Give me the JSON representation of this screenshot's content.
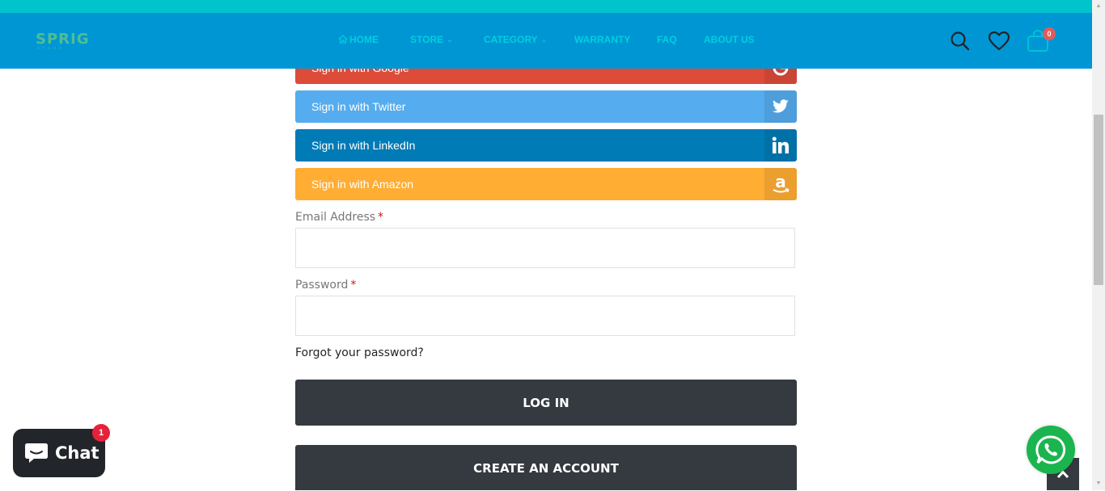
{
  "brand": {
    "logo_text": "SPRIG",
    "logo_tagline": "STORE"
  },
  "nav": {
    "items": [
      {
        "label": "HOME",
        "icon": "home-icon",
        "has_dropdown": false
      },
      {
        "label": "STORE",
        "has_dropdown": true
      },
      {
        "label": "CATEGORY",
        "has_dropdown": true
      },
      {
        "label": "WARRANTY",
        "has_dropdown": false
      },
      {
        "label": "FAQ",
        "has_dropdown": false
      },
      {
        "label": "ABOUT US",
        "has_dropdown": false
      }
    ]
  },
  "header_icons": {
    "search": "search-icon",
    "wishlist": "heart-icon",
    "cart": "cart-icon",
    "cart_count": "0"
  },
  "social_login": [
    {
      "label": "Sign in with Google",
      "icon": "google-icon",
      "color": "#dd4b39"
    },
    {
      "label": "Sign in with Twitter",
      "icon": "twitter-icon",
      "color": "#55acee"
    },
    {
      "label": "Sign in with LinkedIn",
      "icon": "linkedin-icon",
      "color": "#007bb6"
    },
    {
      "label": "Sign in with Amazon",
      "icon": "amazon-icon",
      "color": "#ffad33"
    }
  ],
  "form": {
    "email_label": "Email Address",
    "password_label": "Password",
    "required_mark": "*",
    "email_value": "",
    "password_value": "",
    "forgot_link": "Forgot your password?",
    "login_button": "LOG IN",
    "create_account_button": "CREATE AN ACCOUNT"
  },
  "chat_widget": {
    "label": "Chat",
    "badge": "1",
    "icon": "chat-bubble-icon"
  },
  "floating": {
    "whatsapp_icon": "whatsapp-icon",
    "back_to_top_icon": "chevron-up-icon"
  },
  "colors": {
    "top_strip": "#00c4cc",
    "header": "#0096d4",
    "nav_text": "#00d0de",
    "dark_button": "#343a40",
    "whatsapp": "#1ab54e"
  }
}
